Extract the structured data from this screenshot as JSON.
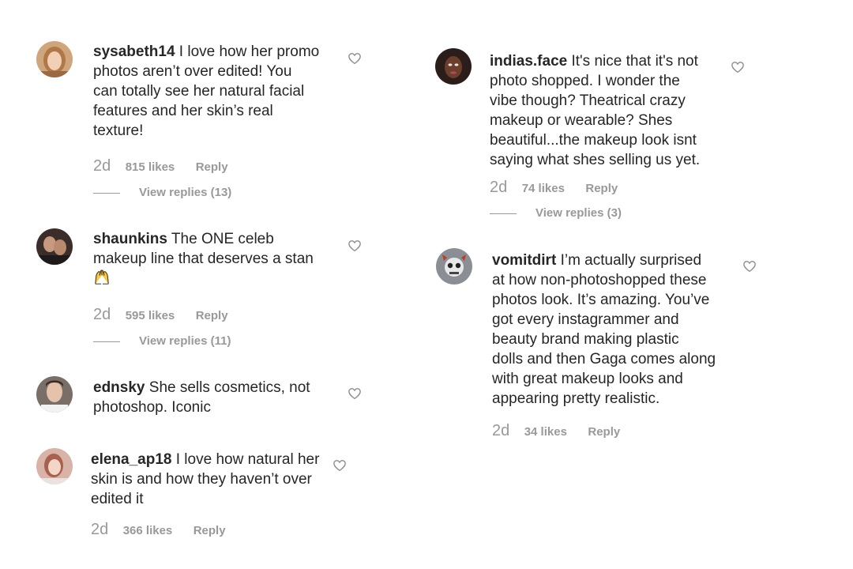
{
  "comments": [
    {
      "username": "sysabeth14",
      "lines": [
        "I love how her promo",
        "photos aren’t over edited! You",
        "can totally see her natural facial",
        "features and her skin’s real",
        "texture!"
      ],
      "age": "2d",
      "likes": "815 likes",
      "reply": "Reply",
      "view_replies": "View replies (13)"
    },
    {
      "username": "shaunkins",
      "lines": [
        "The ONE celeb",
        "makeup line that deserves a stan"
      ],
      "emoji": "raising-hands-emoji",
      "age": "2d",
      "likes": "595 likes",
      "reply": "Reply",
      "view_replies": "View replies (11)"
    },
    {
      "username": "ednsky",
      "lines": [
        "She sells cosmetics, not",
        "photoshop. Iconic"
      ]
    },
    {
      "username": "elena_ap18",
      "lines": [
        "I love how natural her",
        "skin is and how they haven’t over",
        "edited it"
      ],
      "age": "2d",
      "likes": "366 likes",
      "reply": "Reply"
    },
    {
      "username": "indias.face",
      "lines": [
        "It's nice that it's not",
        "photo shopped. I wonder the",
        "vibe though? Theatrical crazy",
        "makeup or wearable? Shes",
        "beautiful...the makeup look isnt",
        "saying what shes selling us yet."
      ],
      "age": "2d",
      "likes": "74 likes",
      "reply": "Reply",
      "view_replies": "View replies (3)"
    },
    {
      "username": "vomitdirt",
      "lines": [
        "I’m actually surprised",
        "at how non-photoshopped these",
        "photos look. It’s amazing. You’ve",
        "got every instagrammer and",
        "beauty brand making plastic",
        "dolls and then Gaga comes along",
        "with great makeup looks and",
        "appearing pretty realistic."
      ],
      "age": "2d",
      "likes": "34 likes",
      "reply": "Reply"
    }
  ],
  "icons": {
    "heart": "heart-outline-icon",
    "avatar": "avatar"
  },
  "colors": {
    "text": "#262626",
    "muted": "#999999",
    "background": "#ffffff"
  }
}
